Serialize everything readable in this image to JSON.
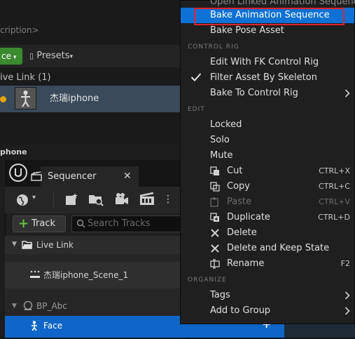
{
  "background": {
    "description_field": "cription>",
    "face_button": "ce",
    "presets_label": "Presets",
    "livelink_header": "ive Link (1)",
    "subject_name": "杰瑞iphone",
    "phone_panel_title": "phone"
  },
  "sequencer": {
    "tab_title": "Sequencer",
    "track_button": "Track",
    "search_placeholder": "Search Tracks",
    "rows": {
      "live_link": "Live Link",
      "scene": "杰瑞iphone_Scene_1",
      "bp": "BP_Abc",
      "face": "Face"
    }
  },
  "menu": {
    "top_partial": "Open Linked Animation Sequence",
    "items_top": [
      {
        "label": "Bake Animation Sequence"
      },
      {
        "label": "Bake Pose Asset"
      }
    ],
    "section_control_rig": "CONTROL RIG",
    "items_control_rig": [
      {
        "label": "Edit With FK Control Rig"
      },
      {
        "label": "Filter Asset By Skeleton"
      },
      {
        "label": "Bake To Control Rig"
      }
    ],
    "section_edit": "EDIT",
    "items_edit": [
      {
        "label": "Locked"
      },
      {
        "label": "Solo"
      },
      {
        "label": "Mute"
      },
      {
        "label": "Cut",
        "shortcut": "CTRL+X"
      },
      {
        "label": "Copy",
        "shortcut": "CTRL+C"
      },
      {
        "label": "Paste",
        "shortcut": "CTRL+V"
      },
      {
        "label": "Duplicate",
        "shortcut": "CTRL+D"
      },
      {
        "label": "Delete"
      },
      {
        "label": "Delete and Keep State"
      },
      {
        "label": "Rename",
        "shortcut": "F2"
      }
    ],
    "section_organize": "ORGANIZE",
    "items_organize": [
      {
        "label": "Tags"
      },
      {
        "label": "Add to Group"
      }
    ]
  },
  "colors": {
    "highlight": "#0e71d6",
    "annotation_box": "#e0232d",
    "live_dot": "#e7a300",
    "face_row": "#0f66c8"
  }
}
